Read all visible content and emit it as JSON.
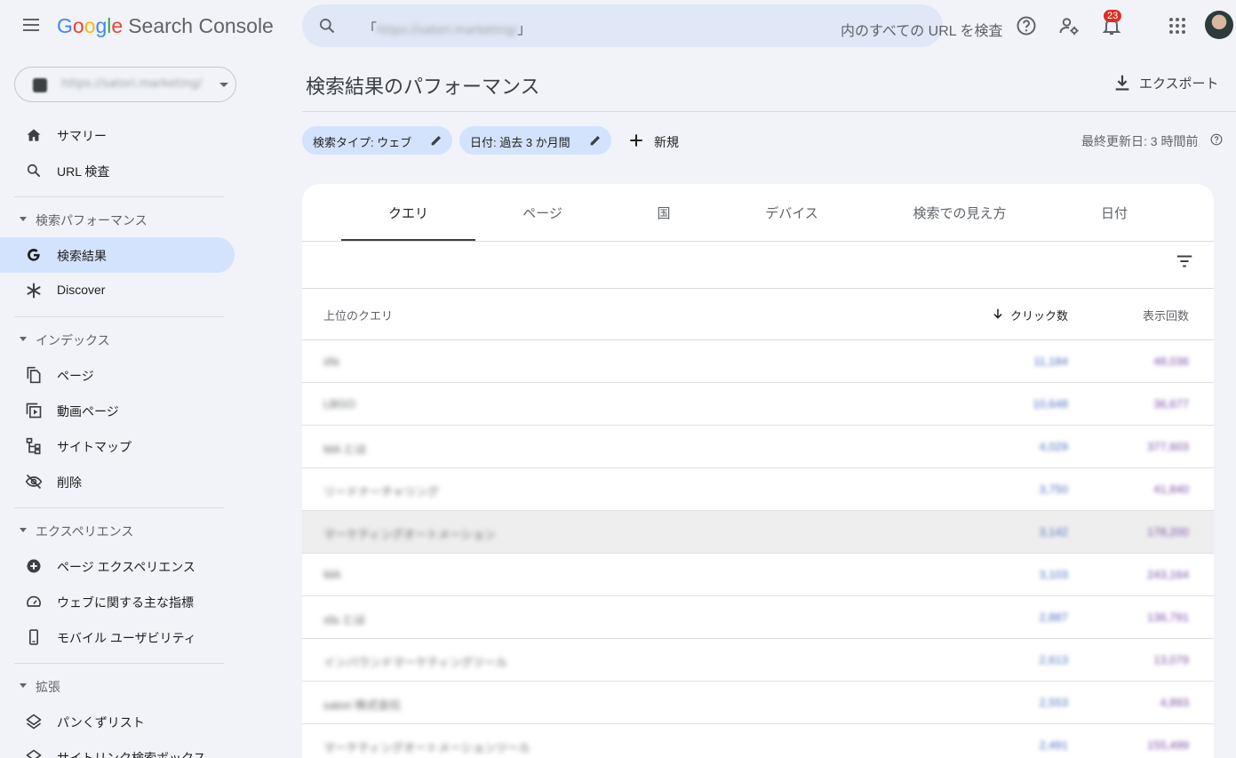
{
  "app": {
    "logo_letters": [
      "G",
      "o",
      "o",
      "g",
      "l",
      "e"
    ],
    "product": "Search Console",
    "search_url": "https://satori.marketing/",
    "search_placeholder": "内のすべての URL を検査",
    "notification_count": "23"
  },
  "sidebar": {
    "property": "https://satori.marketing/",
    "items": {
      "summary": "サマリー",
      "url_inspect": "URL 検査",
      "section_performance": "検索パフォーマンス",
      "search_results": "検索結果",
      "discover": "Discover",
      "section_index": "インデックス",
      "pages": "ページ",
      "video_pages": "動画ページ",
      "sitemap": "サイトマップ",
      "removals": "削除",
      "section_experience": "エクスペリエンス",
      "page_experience": "ページ エクスペリエンス",
      "web_vitals": "ウェブに関する主な指標",
      "mobile_usability": "モバイル ユーザビリティ",
      "section_enhancements": "拡張",
      "breadcrumbs": "パンくずリスト",
      "sitelinks_searchbox": "サイトリンク検索ボックス"
    }
  },
  "main": {
    "title": "検索結果のパフォーマンス",
    "export_label": "エクスポート",
    "filter_search_type": "検索タイプ: ウェブ",
    "filter_date": "日付: 過去 3 か月間",
    "new_label": "新規",
    "last_updated": "最終更新日: 3 時間前",
    "tabs": [
      "クエリ",
      "ページ",
      "国",
      "デバイス",
      "検索での見え方",
      "日付"
    ],
    "table": {
      "col_query": "上位のクエリ",
      "col_clicks": "クリック数",
      "col_impressions": "表示回数",
      "rows": [
        {
          "query": "sfa",
          "clicks": "11,184",
          "impressions": "48,036"
        },
        {
          "query": "LBGO",
          "clicks": "10,648",
          "impressions": "36,677"
        },
        {
          "query": "MA とは",
          "clicks": "4,029",
          "impressions": "377,603"
        },
        {
          "query": "リードナーチャリング",
          "clicks": "3,750",
          "impressions": "41,840"
        },
        {
          "query": "マーケティングオートメーション",
          "clicks": "3,142",
          "impressions": "178,200"
        },
        {
          "query": "MA",
          "clicks": "3,103",
          "impressions": "243,164"
        },
        {
          "query": "sfa とは",
          "clicks": "2,887",
          "impressions": "136,791"
        },
        {
          "query": "インバウンドマーケティングツール",
          "clicks": "2,613",
          "impressions": "13,079"
        },
        {
          "query": "satori 株式会社",
          "clicks": "2,553",
          "impressions": "4,893"
        },
        {
          "query": "マーケティングオートメーションツール",
          "clicks": "2,491",
          "impressions": "155,499"
        }
      ]
    }
  }
}
